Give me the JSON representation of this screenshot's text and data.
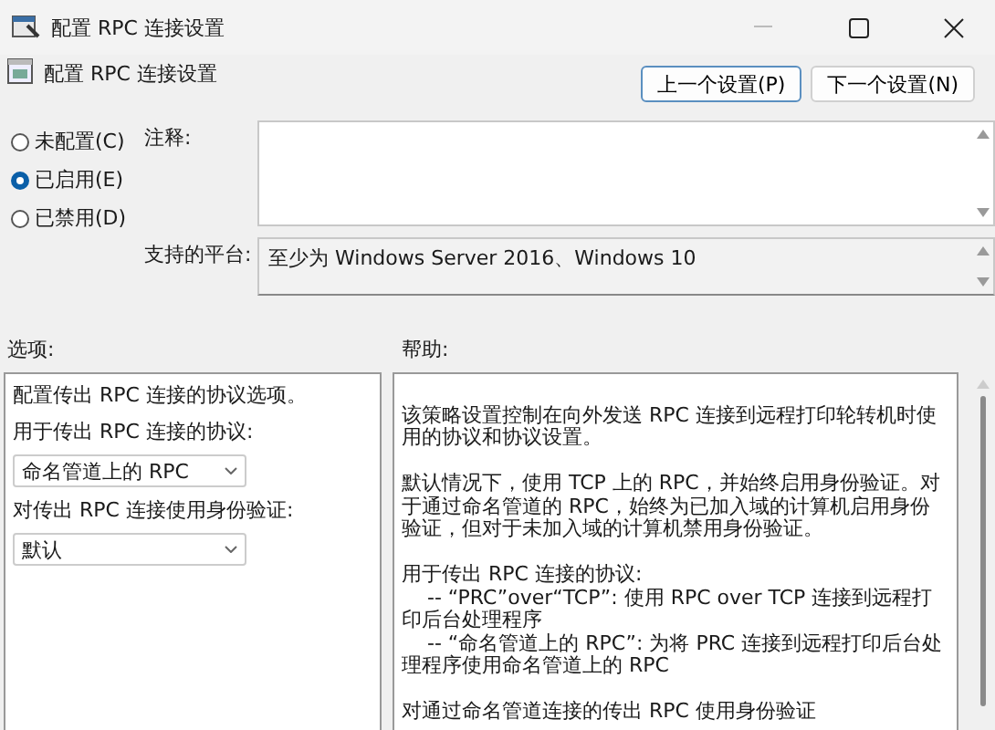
{
  "window": {
    "title": "配置 RPC 连接设置"
  },
  "header": {
    "title": "配置 RPC 连接设置",
    "buttons": [
      {
        "label": "上一个设置(P)",
        "selected": true
      },
      {
        "label": "下一个设置(N)",
        "selected": false
      }
    ]
  },
  "state_options": [
    {
      "label": "未配置(C)",
      "selected": false
    },
    {
      "label": "已启用(E)",
      "selected": true
    },
    {
      "label": "已禁用(D)",
      "selected": false
    }
  ],
  "comment": {
    "label": "注释:"
  },
  "platform": {
    "label": "支持的平台:",
    "value": "至少为 Windows Server 2016、Windows 10"
  },
  "options": {
    "label": "选项:",
    "items": [
      {
        "kind": "text",
        "text": "配置传出 RPC 连接的协议选项。"
      },
      {
        "kind": "text",
        "text": "用于传出 RPC 连接的协议:"
      },
      {
        "kind": "dropdown",
        "text": "命名管道上的 RPC"
      },
      {
        "kind": "text",
        "text": "对传出 RPC 连接使用身份验证:"
      },
      {
        "kind": "dropdown",
        "text": "默认"
      }
    ]
  },
  "help": {
    "label": "帮助:",
    "paragraphs": [
      {
        "kind": "text",
        "text": "该策略设置控制在向外发送 RPC 连接到远程打印轮转机时使用的协议和协议设置。"
      },
      {
        "kind": "gap"
      },
      {
        "kind": "text",
        "text": "默认情况下，使用 TCP 上的 RPC，并始终启用身份验证。对于通过命名管道的 RPC，始终为已加入域的计算机启用身份验证，但对于未加入域的计算机禁用身份验证。"
      },
      {
        "kind": "gap"
      },
      {
        "kind": "text",
        "text": "用于传出 RPC 连接的协议:"
      },
      {
        "kind": "indent",
        "text": "-- “PRC”over“TCP”: 使用 RPC over TCP 连接到远程打印后台处理程序"
      },
      {
        "kind": "indent",
        "text": "-- “命名管道上的 RPC”: 为将 PRC 连接到远程打印后台处理程序使用命名管道上的 RPC"
      },
      {
        "kind": "gap"
      },
      {
        "kind": "text",
        "text": "对通过命名管道连接的传出 RPC 使用身份验证"
      }
    ]
  }
}
